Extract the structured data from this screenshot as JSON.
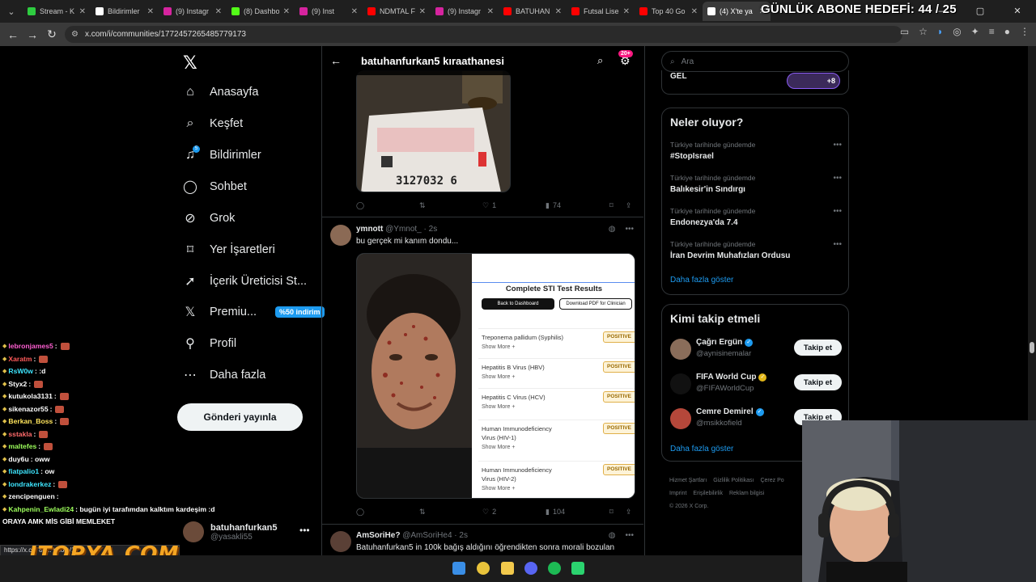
{
  "stream_overlay": {
    "goal_text": "GÜNLÜK ABONE HEDEFİ: 44 / 25",
    "watermark": "ITOPYA.COM"
  },
  "browser": {
    "tabs": [
      {
        "label": "Stream - K",
        "favicon_color": "#2ecc40"
      },
      {
        "label": "Bildirimler",
        "favicon_color": "#ffffff"
      },
      {
        "label": "(9) Instagr",
        "favicon_color": "#d6249f"
      },
      {
        "label": "(8) Dashbo",
        "favicon_color": "#53fc18"
      },
      {
        "label": "(9) Inst",
        "favicon_color": "#d6249f"
      },
      {
        "label": "NDMTAL F",
        "favicon_color": "#ff0000"
      },
      {
        "label": "(9) Instagr",
        "favicon_color": "#d6249f"
      },
      {
        "label": "BATUHAN",
        "favicon_color": "#ff0000"
      },
      {
        "label": "Futsal Lise",
        "favicon_color": "#ff0000"
      },
      {
        "label": "Top 40 Go",
        "favicon_color": "#ff0000"
      },
      {
        "label": "(4) X'te ya",
        "favicon_color": "#ffffff"
      }
    ],
    "url": "x.com/i/communities/1772457265485779173",
    "status_url": "https://x.c...              86...           photo/1"
  },
  "nav": {
    "items": [
      {
        "label": "Anasayfa",
        "icon": "home-icon"
      },
      {
        "label": "Keşfet",
        "icon": "search-icon"
      },
      {
        "label": "Bildirimler",
        "icon": "bell-icon",
        "badge": "5"
      },
      {
        "label": "Sohbet",
        "icon": "chat-icon"
      },
      {
        "label": "Grok",
        "icon": "grok-icon"
      },
      {
        "label": "Yer İşaretleri",
        "icon": "bookmark-icon"
      },
      {
        "label": "İçerik Üreticisi St...",
        "icon": "rocket-icon"
      },
      {
        "label": "Premiu...",
        "icon": "x-icon",
        "badge_text": "%50 indirim"
      },
      {
        "label": "Profil",
        "icon": "person-icon"
      },
      {
        "label": "Daha fazla",
        "icon": "more-icon"
      }
    ],
    "post_button": "Gönderi yayınla",
    "account": {
      "name": "batuhanfurkan5",
      "handle": "@yasakli55"
    }
  },
  "main": {
    "title": "batuhanfurkan5 kıraathanesi",
    "notif_badge": "20+",
    "ticket_number": "3127032 6",
    "post1_stats": {
      "reply": "",
      "repost": "",
      "like": "1",
      "views": "74"
    },
    "post2": {
      "name": "ymnott",
      "handle": "@Ymnot_",
      "time": "· 2s",
      "text": "bu gerçek mi kanım dondu...",
      "stats": {
        "reply": "",
        "repost": "",
        "like": "2",
        "views": "104"
      },
      "results_title": "Complete STI Test Results",
      "btn_back": "Back to Dashboard",
      "btn_pdf": "Download PDF for Clinician",
      "tests": [
        {
          "name": "Treponema pallidum (Syphilis)",
          "name2": "",
          "status": "POSITIVE"
        },
        {
          "name": "Hepatitis B Virus (HBV)",
          "name2": "",
          "status": "POSITIVE"
        },
        {
          "name": "Hepatitis C Virus (HCV)",
          "name2": "",
          "status": "POSITIVE"
        },
        {
          "name": "Human Immunodeficiency",
          "name2": "Virus (HIV-1)",
          "status": "POSITIVE"
        },
        {
          "name": "Human Immunodeficiency",
          "name2": "Virus (HIV-2)",
          "status": "POSITIVE"
        }
      ],
      "show_more": "Show More +"
    },
    "post3": {
      "name": "AmSoriHe?",
      "handle": "@AmSoriHe4",
      "time": "· 2s",
      "text": "Batuhanfurkan5 in 100k bağış aldığını öğrendikten sonra morali bozulan"
    }
  },
  "right": {
    "search_placeholder": "Ara",
    "gel_text": "GEL",
    "gel_count": "+8",
    "trends_title": "Neler oluyor?",
    "trends": [
      {
        "context": "Türkiye tarihinde gündemde",
        "name": "#StopIsrael"
      },
      {
        "context": "Türkiye tarihinde gündemde",
        "name": "Balıkesir'in Sındırgı"
      },
      {
        "context": "Türkiye tarihinde gündemde",
        "name": "Endonezya'da 7.4"
      },
      {
        "context": "Türkiye tarihinde gündemde",
        "name": "İran Devrim Muhafızları Ordusu"
      }
    ],
    "show_more": "Daha fazla göster",
    "follow_title": "Kimi takip etmeli",
    "follow": [
      {
        "name": "Çağrı Ergün",
        "handle": "@aynisinemalar",
        "button": "Takip et",
        "badge_color": "#1d9bf0",
        "avatar_color": "#8a6d5a"
      },
      {
        "name": "FIFA World Cup",
        "handle": "@FIFAWorldCup",
        "button": "Takip et",
        "badge_color": "#e2b719",
        "avatar_color": "#111111"
      },
      {
        "name": "Cemre Demirel",
        "handle": "@msikkofield",
        "button": "Takip et",
        "badge_color": "#1d9bf0",
        "avatar_color": "#b5473a"
      }
    ],
    "footer": [
      "Hizmet Şartları",
      "Gizlilik Politikası",
      "Çerez Po",
      "Imprint",
      "Erişilebilirlik",
      "Reklam bilgisi",
      "© 2026 X Corp."
    ]
  },
  "chat": [
    {
      "user": "lebronjames5",
      "color": "#ff5fd2",
      "msg": ":",
      "emote": true
    },
    {
      "user": "Xaratm",
      "color": "#ff5a5a",
      "msg": ":",
      "emote": true
    },
    {
      "user": "RsW0w",
      "color": "#3ee6ff",
      "msg": ": :d",
      "emote": false
    },
    {
      "user": "Styx2",
      "color": "#ffffff",
      "msg": ":",
      "emote": true
    },
    {
      "user": "kutukola3131",
      "color": "#ffffff",
      "msg": ":",
      "emote": true
    },
    {
      "user": "sikenazor55",
      "color": "#ffffff",
      "msg": ":",
      "emote": true
    },
    {
      "user": "Berkan_Boss",
      "color": "#ffe45c",
      "msg": ":",
      "emote": true
    },
    {
      "user": "sstakla",
      "color": "#ff6b6b",
      "msg": ":",
      "emote": true
    },
    {
      "user": "maltefes",
      "color": "#9dff5c",
      "msg": ":",
      "emote": true
    },
    {
      "user": "duy6u",
      "color": "#ffffff",
      "msg": ": oww",
      "emote": false
    },
    {
      "user": "fiatpalio1",
      "color": "#3ee6ff",
      "msg": ": ow",
      "emote": false
    },
    {
      "user": "londrakerkez",
      "color": "#3ee6ff",
      "msg": ":",
      "emote": true
    },
    {
      "user": "zencipenguen",
      "color": "#ffffff",
      "msg": ":",
      "emote": false
    },
    {
      "user": "Kahpenin_Ewladi24",
      "color": "#9dff5c",
      "msg": ": bugün iyi tarafımdan kalktım kardeşim :d",
      "emote": false
    },
    {
      "user": "",
      "color": "#ffffff",
      "msg": "ORAYA AMK MİS GİBİ MEMLEKET",
      "emote": false
    }
  ]
}
